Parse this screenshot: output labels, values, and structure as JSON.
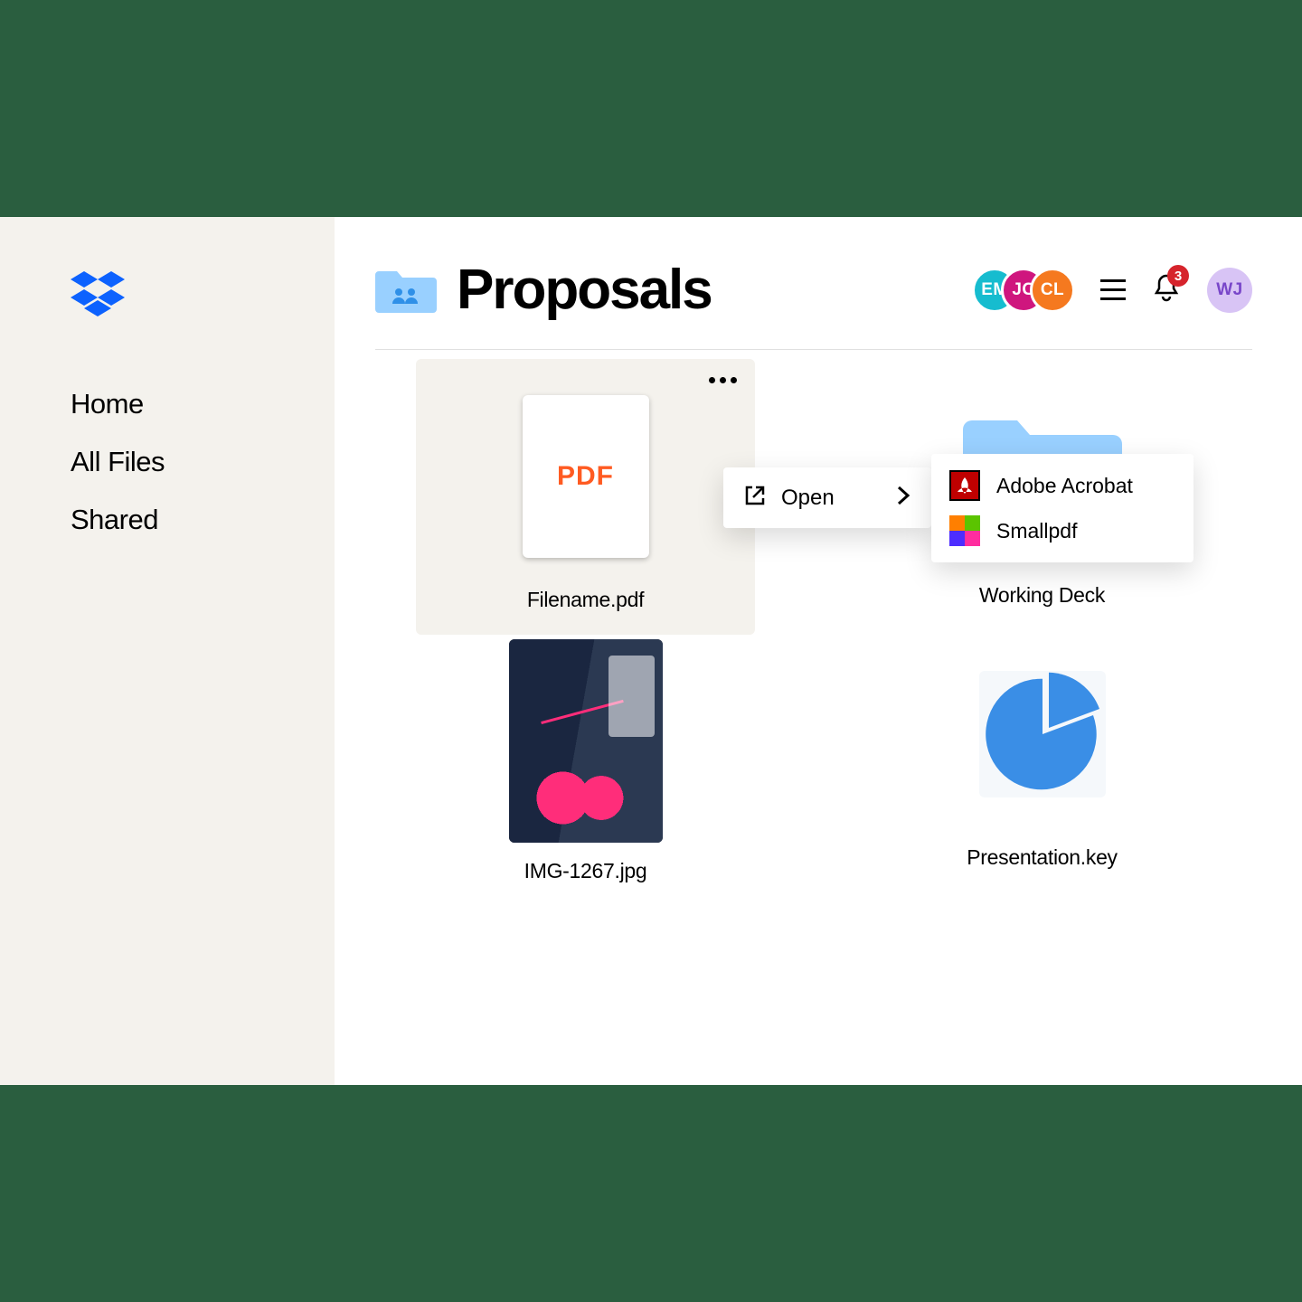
{
  "sidebar": {
    "items": [
      {
        "label": "Home"
      },
      {
        "label": "All Files"
      },
      {
        "label": "Shared"
      }
    ]
  },
  "header": {
    "title": "Proposals",
    "collaborators": [
      {
        "initials": "EM",
        "color": "#16bccf"
      },
      {
        "initials": "JC",
        "color": "#cf167e"
      },
      {
        "initials": "CL",
        "color": "#f5791f"
      }
    ],
    "notification_count": "3",
    "user": {
      "initials": "WJ"
    }
  },
  "context_menu": {
    "open_label": "Open",
    "apps": [
      {
        "name": "Adobe Acrobat"
      },
      {
        "name": "Smallpdf"
      }
    ]
  },
  "files": [
    {
      "name": "Filename.pdf",
      "thumb_label": "PDF"
    },
    {
      "name": "Working Deck"
    },
    {
      "name": "IMG-1267.jpg"
    },
    {
      "name": "Presentation.key"
    }
  ]
}
